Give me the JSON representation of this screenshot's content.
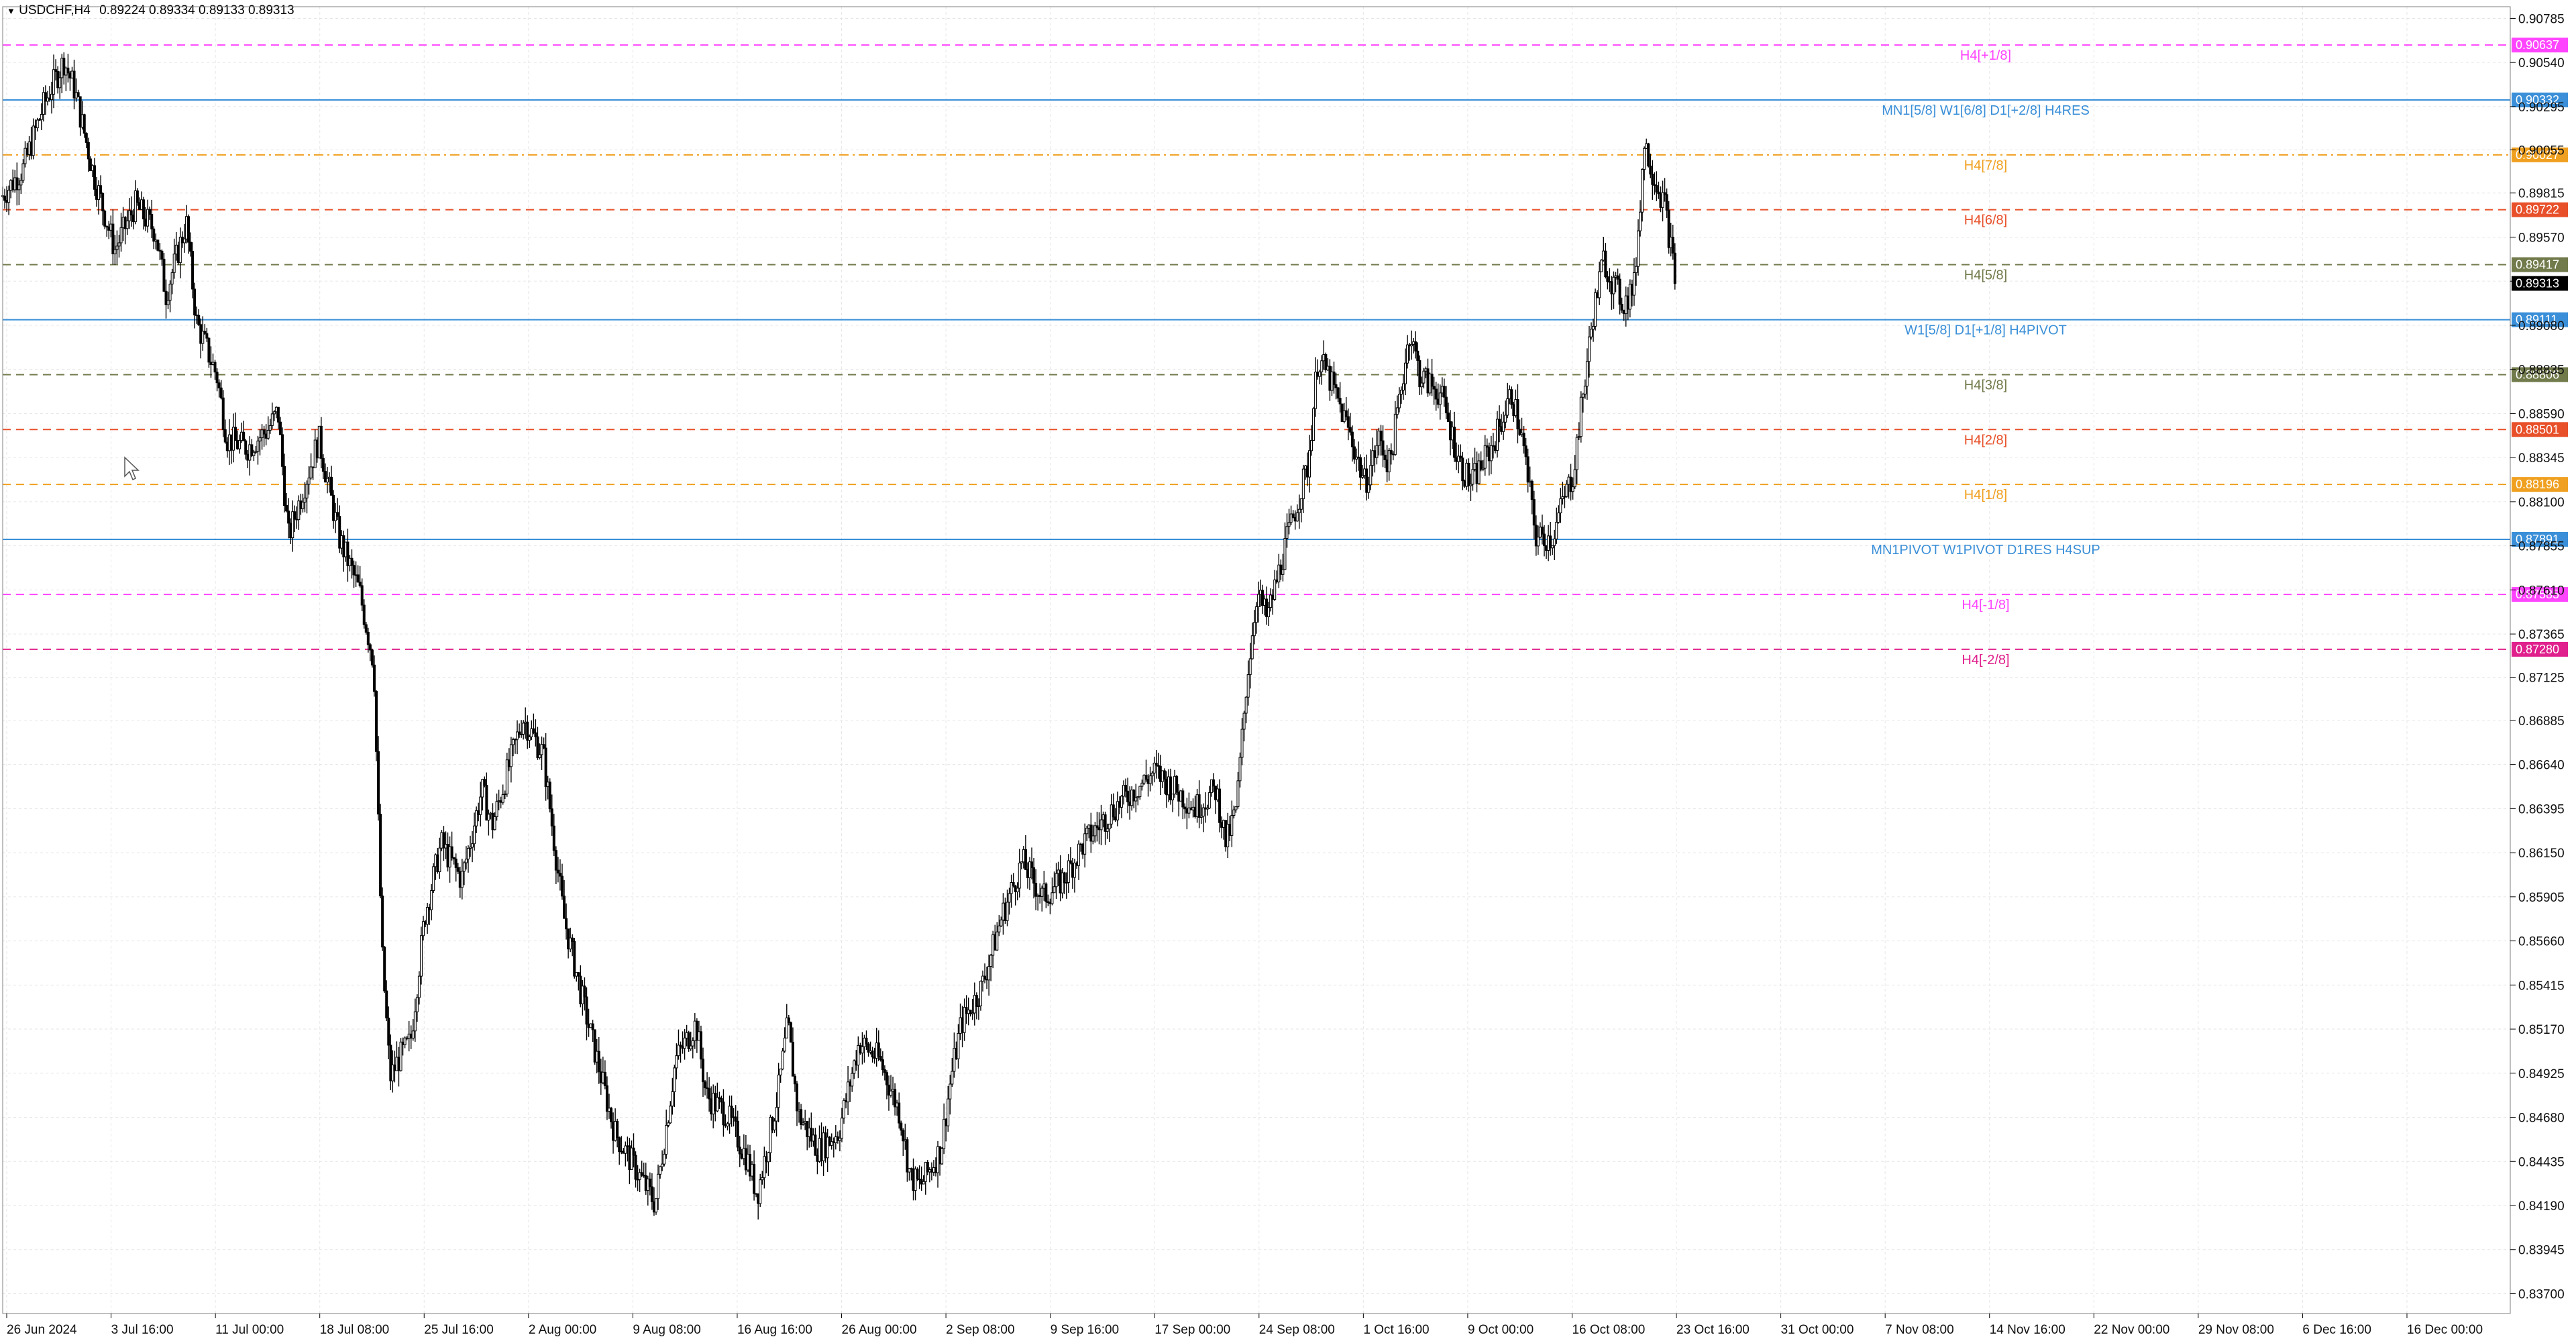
{
  "header": {
    "symbol": "USDCHF,H4",
    "ohlc": "0.89224 0.89334 0.89133 0.89313"
  },
  "colors": {
    "background": "#ffffff",
    "grid": "#e6e6e6",
    "candles": "#000000",
    "axis": "#808080",
    "current_price_tag": "#000000"
  },
  "chart_data": {
    "type": "candlestick",
    "symbol": "USDCHF",
    "timeframe": "H4",
    "ylim": [
      0.8359,
      0.9085
    ],
    "y_ticks": [
      "0.90785",
      "0.90540",
      "0.90295",
      "0.90055",
      "0.89815",
      "0.89570",
      "0.89325",
      "0.89080",
      "0.88835",
      "0.88590",
      "0.88345",
      "0.88100",
      "0.87855",
      "0.87610",
      "0.87365",
      "0.87125",
      "0.86885",
      "0.86640",
      "0.86395",
      "0.86150",
      "0.85905",
      "0.85660",
      "0.85415",
      "0.85170",
      "0.84925",
      "0.84680",
      "0.84435",
      "0.84190",
      "0.83945",
      "0.83700"
    ],
    "x_ticks": [
      "26 Jun 2024",
      "3 Jul 16:00",
      "11 Jul 00:00",
      "18 Jul 08:00",
      "25 Jul 16:00",
      "2 Aug 00:00",
      "9 Aug 08:00",
      "16 Aug 16:00",
      "26 Aug 00:00",
      "2 Sep 08:00",
      "9 Sep 16:00",
      "17 Sep 00:00",
      "24 Sep 08:00",
      "1 Oct 16:00",
      "9 Oct 00:00",
      "16 Oct 08:00",
      "23 Oct 16:00",
      "31 Oct 00:00",
      "7 Nov 08:00",
      "14 Nov 16:00",
      "22 Nov 00:00",
      "29 Nov 08:00",
      "6 Dec 16:00",
      "16 Dec 00:00"
    ],
    "current_price": "0.89313",
    "price_path": [
      [
        0,
        0.898
      ],
      [
        0.01,
        0.8995
      ],
      [
        0.02,
        0.903
      ],
      [
        0.03,
        0.9055
      ],
      [
        0.035,
        0.904
      ],
      [
        0.045,
        0.899
      ],
      [
        0.055,
        0.895
      ],
      [
        0.065,
        0.8975
      ],
      [
        0.075,
        0.896
      ],
      [
        0.08,
        0.8925
      ],
      [
        0.09,
        0.8965
      ],
      [
        0.095,
        0.891
      ],
      [
        0.105,
        0.888
      ],
      [
        0.11,
        0.8845
      ],
      [
        0.12,
        0.884
      ],
      [
        0.13,
        0.885
      ],
      [
        0.135,
        0.886
      ],
      [
        0.14,
        0.879
      ],
      [
        0.155,
        0.8845
      ],
      [
        0.165,
        0.879
      ],
      [
        0.175,
        0.876
      ],
      [
        0.182,
        0.872
      ],
      [
        0.186,
        0.856
      ],
      [
        0.19,
        0.849
      ],
      [
        0.194,
        0.85
      ],
      [
        0.2,
        0.851
      ],
      [
        0.207,
        0.858
      ],
      [
        0.215,
        0.862
      ],
      [
        0.225,
        0.86
      ],
      [
        0.235,
        0.865
      ],
      [
        0.24,
        0.863
      ],
      [
        0.255,
        0.869
      ],
      [
        0.265,
        0.867
      ],
      [
        0.275,
        0.858
      ],
      [
        0.285,
        0.853
      ],
      [
        0.3,
        0.846
      ],
      [
        0.31,
        0.844
      ],
      [
        0.32,
        0.842
      ],
      [
        0.33,
        0.85
      ],
      [
        0.34,
        0.852
      ],
      [
        0.345,
        0.848
      ],
      [
        0.355,
        0.847
      ],
      [
        0.365,
        0.8445
      ],
      [
        0.37,
        0.8425
      ],
      [
        0.38,
        0.848
      ],
      [
        0.385,
        0.852
      ],
      [
        0.39,
        0.847
      ],
      [
        0.4,
        0.845
      ],
      [
        0.41,
        0.846
      ],
      [
        0.42,
        0.851
      ],
      [
        0.43,
        0.85
      ],
      [
        0.44,
        0.847
      ],
      [
        0.445,
        0.8435
      ],
      [
        0.45,
        0.843
      ],
      [
        0.46,
        0.845
      ],
      [
        0.465,
        0.849
      ],
      [
        0.47,
        0.852
      ],
      [
        0.48,
        0.854
      ],
      [
        0.49,
        0.858
      ],
      [
        0.5,
        0.861
      ],
      [
        0.51,
        0.859
      ],
      [
        0.52,
        0.86
      ],
      [
        0.53,
        0.862
      ],
      [
        0.545,
        0.864
      ],
      [
        0.555,
        0.865
      ],
      [
        0.565,
        0.866
      ],
      [
        0.575,
        0.865
      ],
      [
        0.585,
        0.864
      ],
      [
        0.595,
        0.865
      ],
      [
        0.6,
        0.862
      ],
      [
        0.605,
        0.864
      ],
      [
        0.61,
        0.871
      ],
      [
        0.615,
        0.876
      ],
      [
        0.62,
        0.8745
      ],
      [
        0.63,
        0.879
      ],
      [
        0.64,
        0.883
      ],
      [
        0.645,
        0.889
      ],
      [
        0.65,
        0.888
      ],
      [
        0.66,
        0.885
      ],
      [
        0.668,
        0.882
      ],
      [
        0.675,
        0.8845
      ],
      [
        0.68,
        0.883
      ],
      [
        0.69,
        0.8905
      ],
      [
        0.695,
        0.888
      ],
      [
        0.705,
        0.887
      ],
      [
        0.715,
        0.883
      ],
      [
        0.72,
        0.882
      ],
      [
        0.73,
        0.884
      ],
      [
        0.74,
        0.887
      ],
      [
        0.745,
        0.8845
      ],
      [
        0.752,
        0.879
      ],
      [
        0.76,
        0.879
      ],
      [
        0.765,
        0.881
      ],
      [
        0.77,
        0.8825
      ],
      [
        0.78,
        0.8915
      ],
      [
        0.785,
        0.8945
      ],
      [
        0.79,
        0.893
      ],
      [
        0.795,
        0.892
      ],
      [
        0.8,
        0.893
      ],
      [
        0.805,
        0.901
      ],
      [
        0.81,
        0.899
      ],
      [
        0.815,
        0.8975
      ],
      [
        0.82,
        0.8935
      ]
    ],
    "levels": [
      {
        "label": "H4[+1/8]",
        "value": "0.90637",
        "color": "#ff44ff",
        "style": "dashed"
      },
      {
        "label": "MN1[5/8] W1[6/8] D1[+2/8] H4RES",
        "value": "0.90332",
        "color": "#3a8fd8",
        "style": "solid"
      },
      {
        "label": "H4[7/8]",
        "value": "0.90027",
        "color": "#f0a020",
        "style": "dashdot"
      },
      {
        "label": "H4[6/8]",
        "value": "0.89722",
        "color": "#e8502a",
        "style": "dashed"
      },
      {
        "label": "H4[5/8]",
        "value": "0.89417",
        "color": "#707a4a",
        "style": "dashed"
      },
      {
        "label": "W1[5/8] D1[+1/8] H4PIVOT",
        "value": "0.89111",
        "color": "#3a8fd8",
        "style": "solid"
      },
      {
        "label": "H4[3/8]",
        "value": "0.88806",
        "color": "#707a4a",
        "style": "dashed"
      },
      {
        "label": "H4[2/8]",
        "value": "0.88501",
        "color": "#e8502a",
        "style": "dashed"
      },
      {
        "label": "H4[1/8]",
        "value": "0.88196",
        "color": "#f0a020",
        "style": "dashed"
      },
      {
        "label": "MN1PIVOT W1PIVOT D1RES H4SUP",
        "value": "0.87891",
        "color": "#3a8fd8",
        "style": "solid"
      },
      {
        "label": "H4[-1/8]",
        "value": "0.87585",
        "color": "#ff44ff",
        "style": "dashed"
      },
      {
        "label": "H4[-2/8]",
        "value": "0.87280",
        "color": "#e0208c",
        "style": "dashed"
      }
    ]
  }
}
